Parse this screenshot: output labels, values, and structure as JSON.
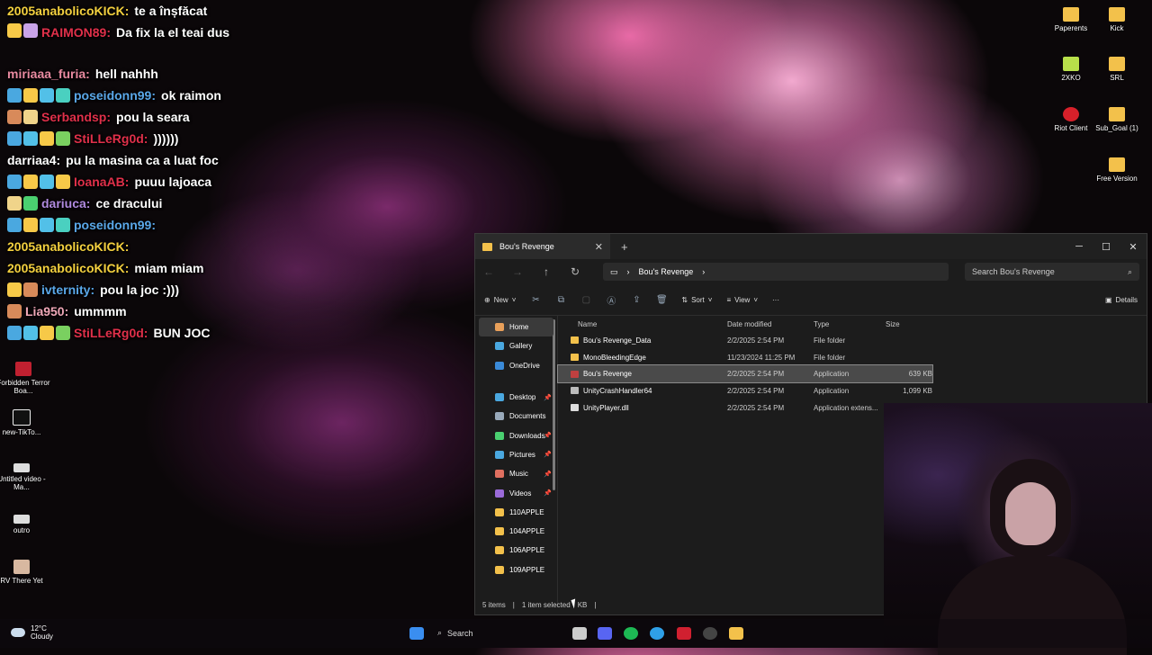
{
  "chat": [
    {
      "user": "2005anabolicoKICK:",
      "msg": "te a înșfăcat",
      "color": "#f4d03f",
      "badges": []
    },
    {
      "user": "RAIMON89:",
      "msg": "Da fix la el teai dus",
      "color": "#e0304a",
      "badges": [
        "#f7c948",
        "#c9a3e8"
      ],
      "tall": true
    },
    {
      "user": "miriaaa_furia:",
      "msg": "hell nahhh",
      "color": "#e88aa0",
      "badges": []
    },
    {
      "user": "poseidonn99:",
      "msg": "ok raimon",
      "color": "#5aa7e8",
      "badges": [
        "#4aa8e0",
        "#f7c948",
        "#52c0e8",
        "#4ad0c0"
      ]
    },
    {
      "user": "Serbandsp:",
      "msg": "pou la seara",
      "color": "#e0304a",
      "badges": [
        "#d88a5a",
        "#f0d48a"
      ]
    },
    {
      "user": "StiLLeRg0d:",
      "msg": "))))))",
      "color": "#e0304a",
      "badges": [
        "#4aa8e0",
        "#52c0e8",
        "#f7c948",
        "#7ad060"
      ]
    },
    {
      "user": "darriaa4:",
      "msg": "pu la masina ca a luat foc",
      "color": "#ffffff",
      "badges": []
    },
    {
      "user": "IoanaAB:",
      "msg": "puuu lajoaca",
      "color": "#e0304a",
      "badges": [
        "#4aa8e0",
        "#f7c948",
        "#52c0e8",
        "#f7c948"
      ]
    },
    {
      "user": "dariuca:",
      "msg": "ce dracului",
      "color": "#b08adf",
      "badges": [
        "#f0d48a",
        "#4ad070"
      ]
    },
    {
      "user": "poseidonn99:",
      "msg": "",
      "color": "#5aa7e8",
      "badges": [
        "#4aa8e0",
        "#f7c948",
        "#52c0e8",
        "#4ad0c0"
      ]
    },
    {
      "user": "2005anabolicoKICK:",
      "msg": "",
      "color": "#f4d03f",
      "badges": []
    },
    {
      "user": "2005anabolicoKICK:",
      "msg": "miam miam",
      "color": "#f4d03f",
      "badges": []
    },
    {
      "user": "ivternity:",
      "msg": "pou la joc :)))",
      "color": "#5aa7e8",
      "badges": [
        "#f7c948",
        "#d88a5a"
      ]
    },
    {
      "user": "Lia950:",
      "msg": "ummmm",
      "color": "#f0a8b8",
      "badges": [
        "#d88a5a"
      ]
    },
    {
      "user": "StiLLeRg0d:",
      "msg": "BUN JOC",
      "color": "#e0304a",
      "badges": [
        "#4aa8e0",
        "#52c0e8",
        "#f7c948",
        "#7ad060"
      ]
    }
  ],
  "desktop_left": [
    {
      "label": "Forbidden Terror Boa..."
    },
    {
      "label": "new-TikTo..."
    },
    {
      "label": "Untitled video - Ma..."
    },
    {
      "label": "outro"
    },
    {
      "label": "RV There Yet"
    }
  ],
  "desktop_right": [
    {
      "label": "Paperents"
    },
    {
      "label": "Kick"
    },
    {
      "label": "2XKO"
    },
    {
      "label": "SRL"
    },
    {
      "label": "Riot Client"
    },
    {
      "label": "Sub_Goal (1)"
    },
    {
      "label": "Free Version"
    }
  ],
  "explorer": {
    "tab_title": "Bou's Revenge",
    "breadcrumb": "Bou's Revenge",
    "search_placeholder": "Search Bou's Revenge",
    "toolbar": {
      "new": "New",
      "sort": "Sort",
      "view": "View",
      "more": "···",
      "details": "Details"
    },
    "nav": [
      {
        "label": "Home",
        "color": "#e9a05a",
        "selected": true
      },
      {
        "label": "Gallery",
        "color": "#4aa8e0"
      },
      {
        "label": "OneDrive",
        "color": "#3a8ad8"
      },
      {
        "label": "Desktop",
        "color": "#4aa8e0",
        "pinned": true
      },
      {
        "label": "Documents",
        "color": "#9ab"
      },
      {
        "label": "Downloads",
        "color": "#4ad070",
        "pinned": true
      },
      {
        "label": "Pictures",
        "color": "#4aa8e0",
        "pinned": true
      },
      {
        "label": "Music",
        "color": "#e07060",
        "pinned": true
      },
      {
        "label": "Videos",
        "color": "#9a6ad8",
        "pinned": true
      },
      {
        "label": "110APPLE",
        "color": "#f3c14b"
      },
      {
        "label": "104APPLE",
        "color": "#f3c14b"
      },
      {
        "label": "106APPLE",
        "color": "#f3c14b"
      },
      {
        "label": "109APPLE",
        "color": "#f3c14b"
      }
    ],
    "pin_glyph": "📌",
    "columns": {
      "name": "Name",
      "date": "Date modified",
      "type": "Type",
      "size": "Size"
    },
    "files": [
      {
        "name": "Bou's Revenge_Data",
        "date": "2/2/2025 2:54 PM",
        "type": "File folder",
        "size": "",
        "icon": "#f3c14b"
      },
      {
        "name": "MonoBleedingEdge",
        "date": "11/23/2024 11:25 PM",
        "type": "File folder",
        "size": "",
        "icon": "#f3c14b"
      },
      {
        "name": "Bou's Revenge",
        "date": "2/2/2025 2:54 PM",
        "type": "Application",
        "size": "639 KB",
        "icon": "#c04040",
        "selected": true
      },
      {
        "name": "UnityCrashHandler64",
        "date": "2/2/2025 2:54 PM",
        "type": "Application",
        "size": "1,099 KB",
        "icon": "#bbbbbb"
      },
      {
        "name": "UnityPlayer.dll",
        "date": "2/2/2025 2:54 PM",
        "type": "Application extens...",
        "size": "",
        "icon": "#dddddd"
      }
    ],
    "status": {
      "items": "5 items",
      "selected": "1 item selected",
      "size": "KB"
    }
  },
  "taskbar": {
    "temp": "12°C",
    "condition": "Cloudy",
    "search": "Search"
  }
}
